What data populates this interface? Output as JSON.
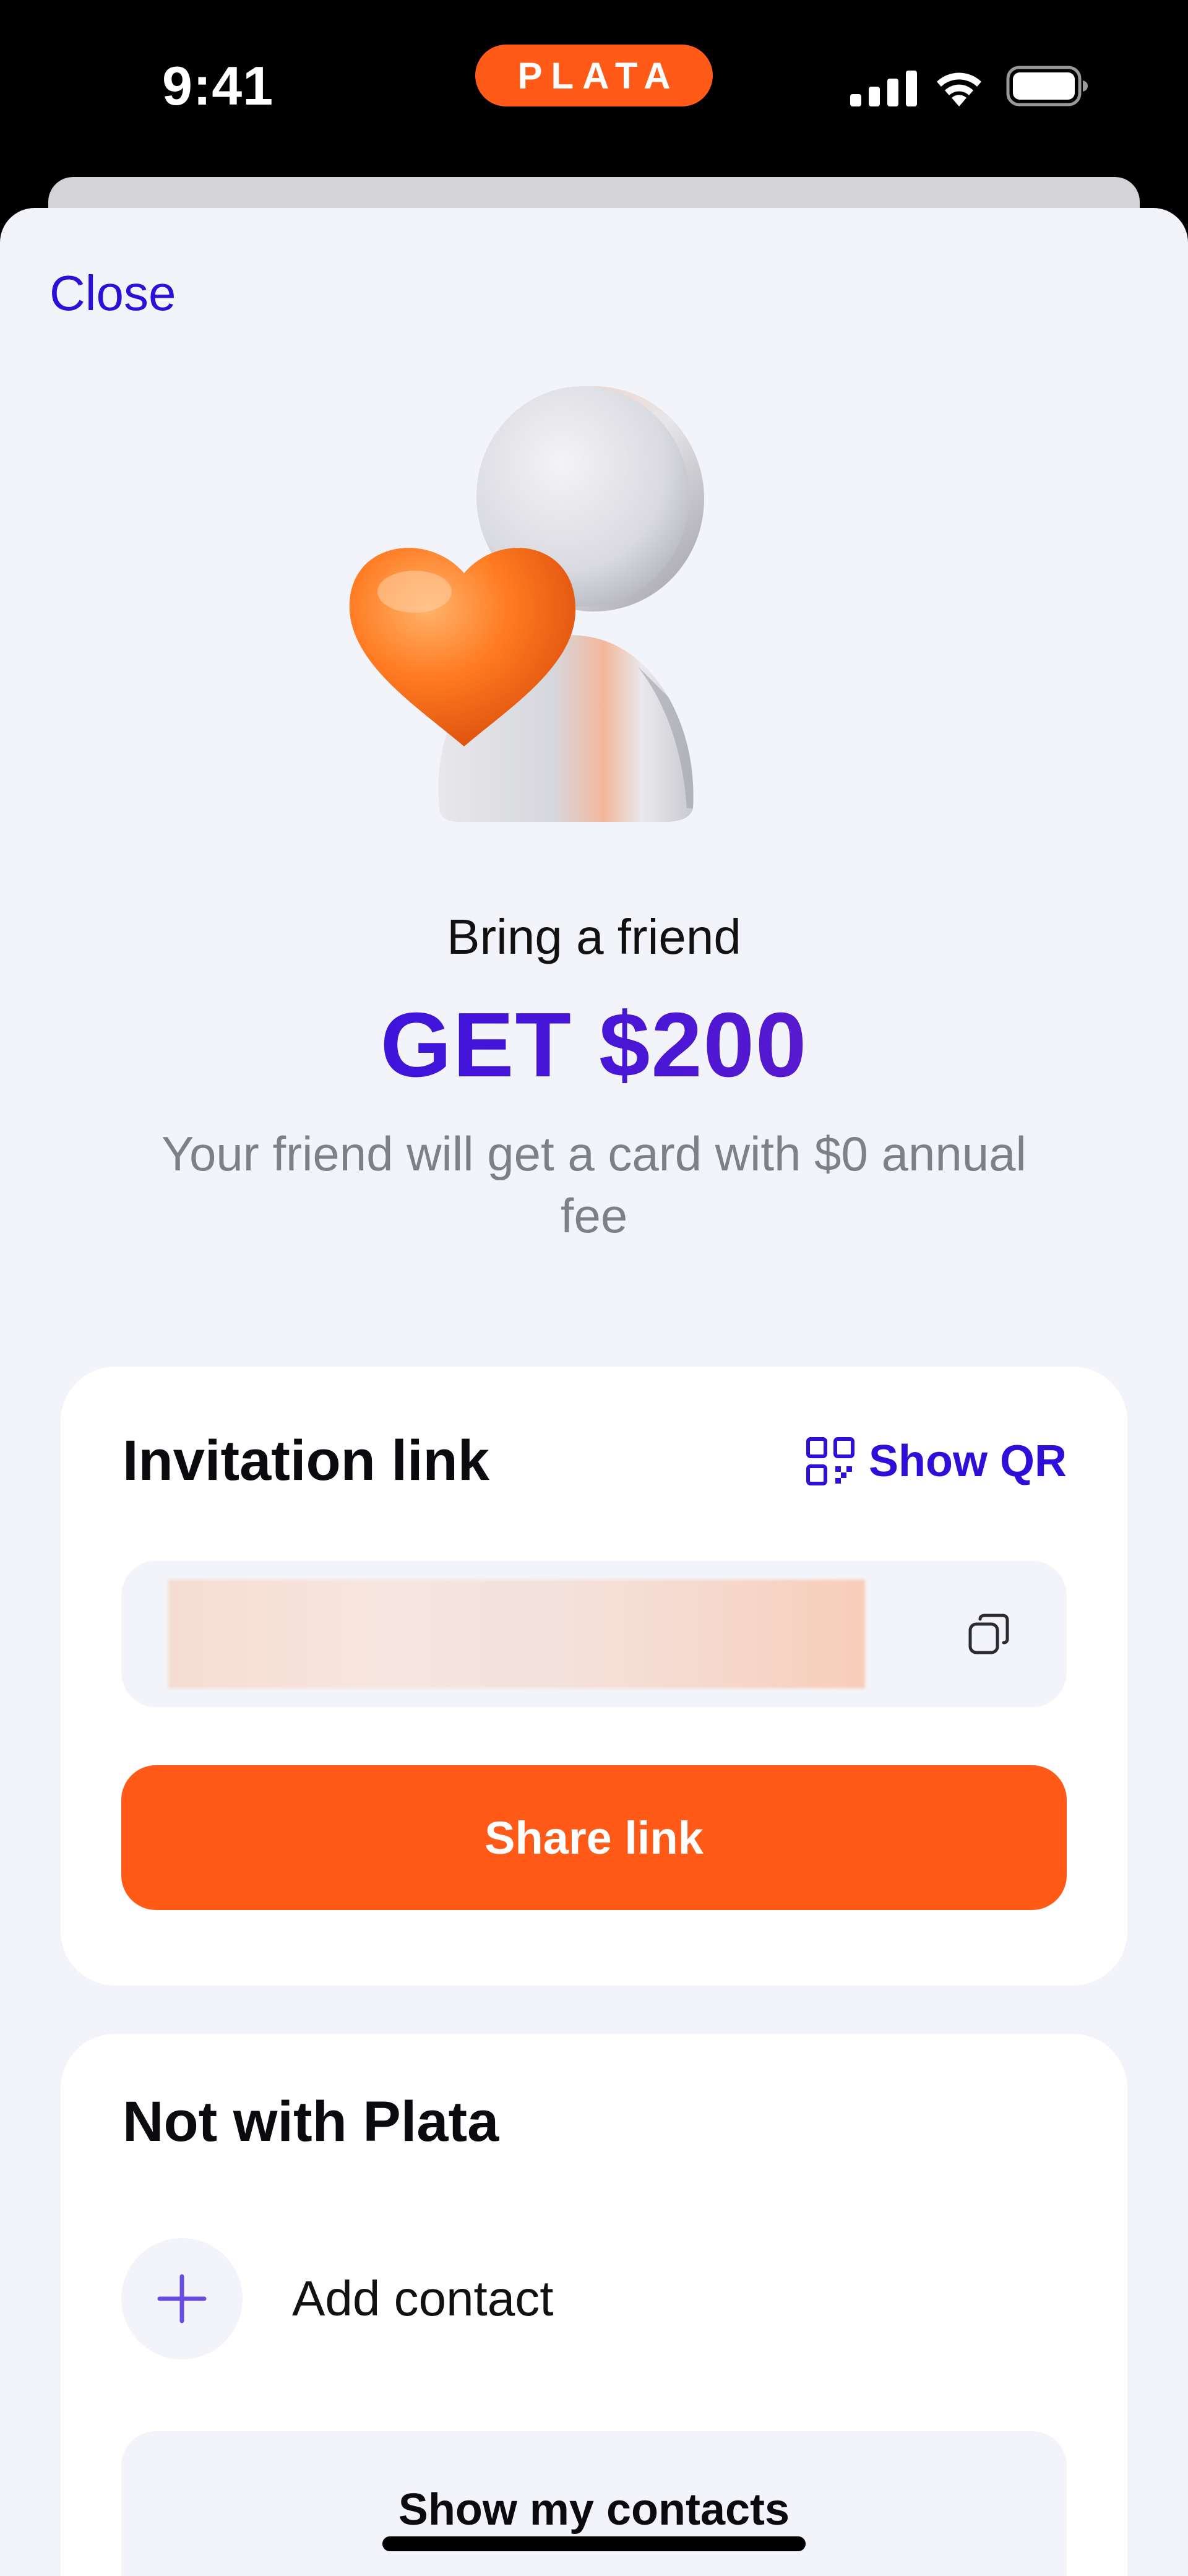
{
  "status_bar": {
    "time": "9:41",
    "brand": "PLATA",
    "icons": [
      "cellular-signal-icon",
      "wifi-icon",
      "battery-icon"
    ]
  },
  "header": {
    "close_label": "Close"
  },
  "hero": {
    "illustration": "friend-heart-illustration",
    "bring_text": "Bring a friend",
    "headline": "GET $200",
    "subtitle": "Your friend will get a card with $0 annual fee"
  },
  "invitation": {
    "title": "Invitation link",
    "show_qr_label": "Show QR",
    "link_value": "",
    "share_label": "Share link"
  },
  "not_with_plata": {
    "title": "Not with Plata",
    "add_contact_label": "Add contact",
    "show_contacts_label": "Show my contacts"
  },
  "colors": {
    "accent_orange": "#FF5A17",
    "accent_violet": "#2E0FD9",
    "background": "#F3F4F9"
  }
}
